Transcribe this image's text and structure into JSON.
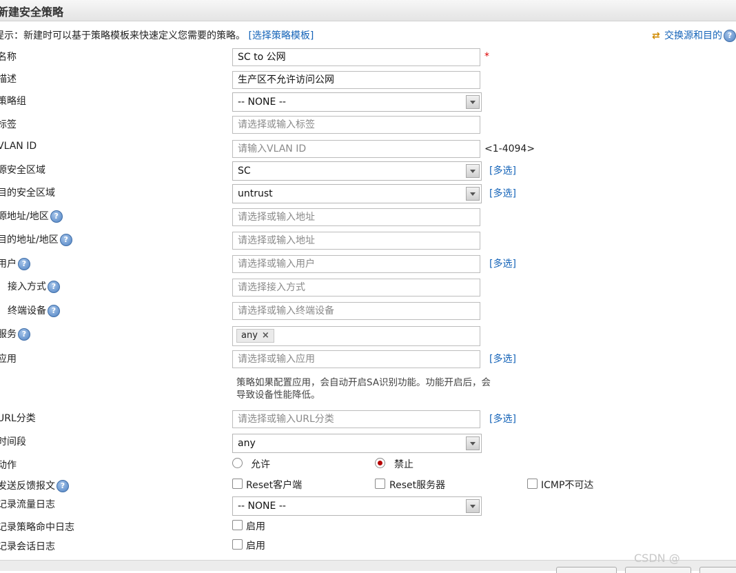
{
  "dialog": {
    "title": "新建安全策略"
  },
  "tip": {
    "text": "提示：新建时可以基于策略模板来快速定义您需要的策略。",
    "link": "[选择策略模板]"
  },
  "swap_link": "交换源和目的",
  "help_glyph": "?",
  "multi_select": "[多选]",
  "fields": {
    "name": {
      "label": "名称",
      "value": "SC to 公网",
      "required_mark": "*"
    },
    "description": {
      "label": "描述",
      "value": "生产区不允许访问公网"
    },
    "policy_group": {
      "label": "策略组",
      "value": "-- NONE --"
    },
    "tag": {
      "label": "标签",
      "placeholder": "请选择或输入标签"
    },
    "vlan_id": {
      "label": "VLAN ID",
      "placeholder": "请输入VLAN ID",
      "range": "<1-4094>"
    },
    "source_zone": {
      "label": "源安全区域",
      "value": "SC"
    },
    "dest_zone": {
      "label": "目的安全区域",
      "value": "untrust"
    },
    "source_address": {
      "label": "源地址/地区",
      "placeholder": "请选择或输入地址"
    },
    "dest_address": {
      "label": "目的地址/地区",
      "placeholder": "请选择或输入地址"
    },
    "user": {
      "label": "用户",
      "placeholder": "请选择或输入用户"
    },
    "access_mode": {
      "label": "接入方式",
      "placeholder": "请选择接入方式"
    },
    "terminal_device": {
      "label": "终端设备",
      "placeholder": "请选择或输入终端设备"
    },
    "service": {
      "label": "服务",
      "tag": "any",
      "tag_close": "×"
    },
    "application": {
      "label": "应用",
      "placeholder": "请选择或输入应用",
      "note": "策略如果配置应用，会自动开启SA识别功能。功能开启后，会导致设备性能降低。"
    },
    "url_category": {
      "label": "URL分类",
      "placeholder": "请选择或输入URL分类"
    },
    "time_range": {
      "label": "时间段",
      "value": "any"
    },
    "action": {
      "label": "动作",
      "options": [
        "允许",
        "禁止"
      ],
      "selected": "禁止"
    },
    "feedback": {
      "label": "发送反馈报文",
      "options": [
        "Reset客户端",
        "Reset服务器",
        "ICMP不可达"
      ]
    },
    "traffic_log": {
      "label": "记录流量日志",
      "value": "-- NONE --"
    },
    "policy_hit_log": {
      "label": "记录策略命中日志",
      "option": "启用"
    },
    "session_log": {
      "label": "记录会话日志",
      "option": "启用"
    }
  },
  "watermark": "CSDN @"
}
